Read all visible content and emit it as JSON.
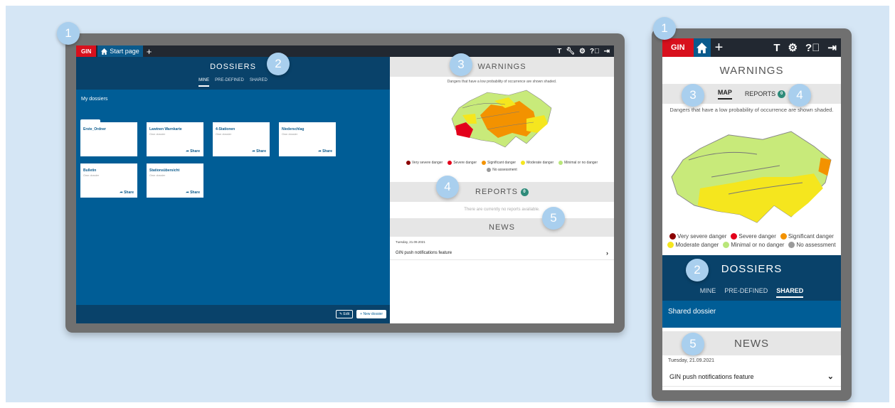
{
  "app": {
    "brand": "GIN",
    "tab_label": "Start page",
    "toolbar_text_icon": "T"
  },
  "colors": {
    "brand_red": "#d8101d",
    "blue": "#005d96",
    "dark_blue": "#09426a",
    "badge": "#2e8b7a"
  },
  "dossiers": {
    "title": "DOSSIERS",
    "tabs": [
      "MINE",
      "PRE-DEFINED",
      "SHARED"
    ],
    "section": "My dossiers",
    "cards": [
      {
        "title": "Erste_Ordner",
        "subtitle": "",
        "share": ""
      },
      {
        "title": "Lawinen Warnkarte",
        "subtitle": "Own dossier",
        "share": "Share"
      },
      {
        "title": "4-Stationen",
        "subtitle": "Own dossier",
        "share": "Share"
      },
      {
        "title": "Niederschlag",
        "subtitle": "Own dossier",
        "share": "Share"
      },
      {
        "title": "Bulletin",
        "subtitle": "Own dossier",
        "share": "Share"
      },
      {
        "title": "Stationsübersicht",
        "subtitle": "Own dossier",
        "share": "Share"
      }
    ],
    "edit_button": "Edit",
    "new_button": "New dossier"
  },
  "warnings": {
    "title": "WARNINGS",
    "note": "Dangers that have a low probability of occurrence are shown shaded.",
    "legend": [
      {
        "label": "Very severe danger",
        "color": "#8b0000"
      },
      {
        "label": "Severe danger",
        "color": "#e3001b"
      },
      {
        "label": "Significant danger",
        "color": "#f39200"
      },
      {
        "label": "Moderate danger",
        "color": "#f5e61e"
      },
      {
        "label": "Minimal or no danger",
        "color": "#b9e67a"
      },
      {
        "label": "No assessment",
        "color": "#9a9a9a"
      }
    ]
  },
  "reports": {
    "title": "REPORTS",
    "count": "0",
    "empty": "There are currently no reports available."
  },
  "news": {
    "title": "NEWS",
    "date": "Tuesday, 21.09.2021",
    "item": "GIN push notifications feature"
  },
  "mobile": {
    "warnings_tabs": {
      "map": "MAP",
      "reports": "REPORTS"
    },
    "dossier_tabs": [
      "MINE",
      "PRE-DEFINED",
      "SHARED"
    ],
    "shared_item": "Shared dossier"
  },
  "callouts": {
    "c1": "1",
    "c2": "2",
    "c3": "3",
    "c4": "4",
    "c5": "5"
  }
}
